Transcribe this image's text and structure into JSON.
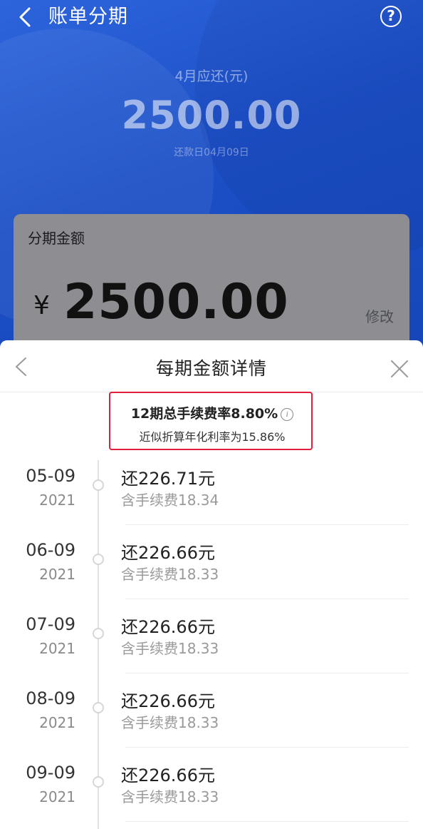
{
  "header": {
    "title": "账单分期",
    "help_icon": "?"
  },
  "bill": {
    "label": "4月应还(元)",
    "amount": "2500.00",
    "due_date": "还款日04月09日"
  },
  "card": {
    "title": "分期金额",
    "currency": "¥",
    "amount": "2500.00",
    "edit_label": "修改"
  },
  "sheet": {
    "title": "每期金额详情",
    "rate_main": "12期总手续费率8.80%",
    "info_icon": "i",
    "rate_sub": "近似折算年化利率为15.86%",
    "highlight_color": "#e0203a",
    "installments": [
      {
        "date": "05-09",
        "year": "2021",
        "pay": "还226.71元",
        "fee": "含手续费18.34"
      },
      {
        "date": "06-09",
        "year": "2021",
        "pay": "还226.66元",
        "fee": "含手续费18.33"
      },
      {
        "date": "07-09",
        "year": "2021",
        "pay": "还226.66元",
        "fee": "含手续费18.33"
      },
      {
        "date": "08-09",
        "year": "2021",
        "pay": "还226.66元",
        "fee": "含手续费18.33"
      },
      {
        "date": "09-09",
        "year": "2021",
        "pay": "还226.66元",
        "fee": "含手续费18.33"
      }
    ]
  },
  "colors": {
    "header_blue": "#1f4fc4",
    "card_gray": "#8e8e92"
  }
}
